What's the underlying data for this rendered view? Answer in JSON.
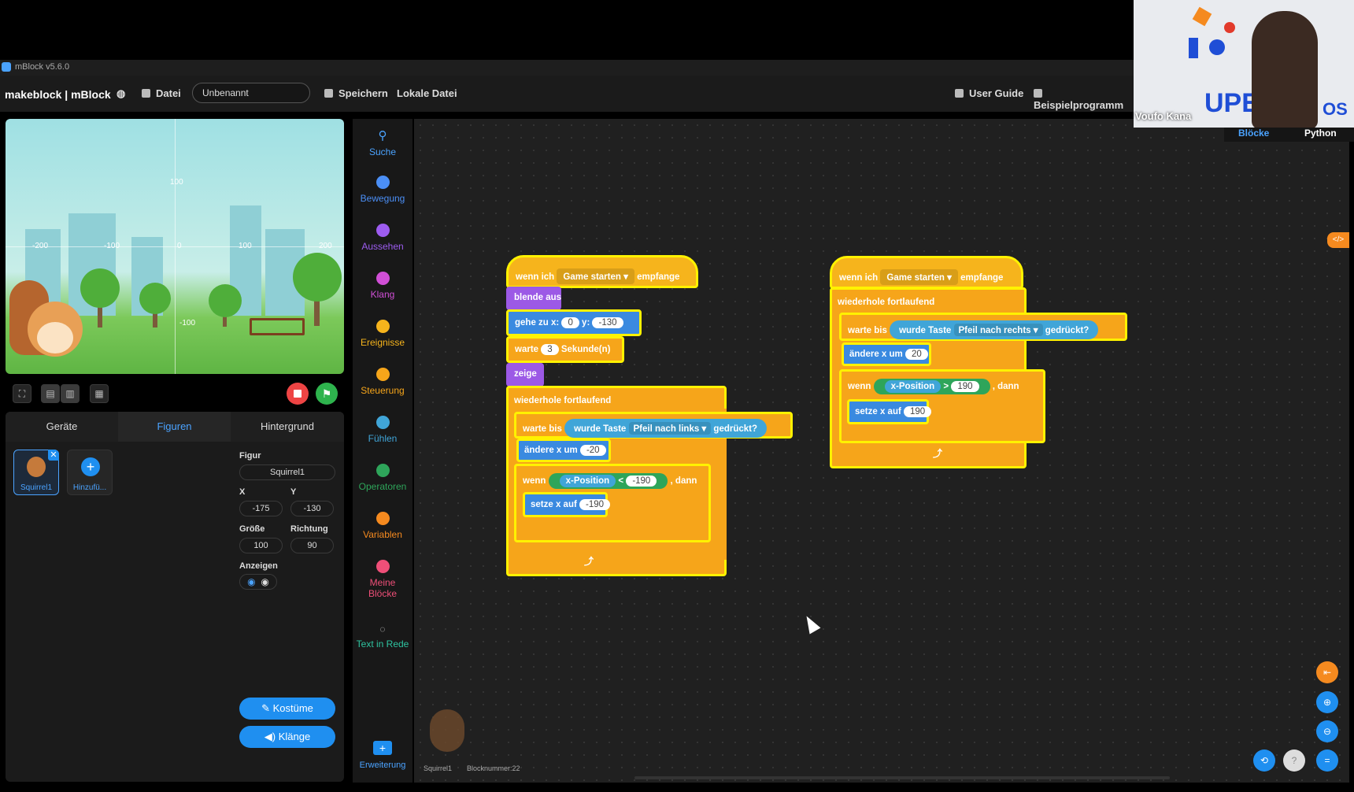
{
  "window": {
    "title": "mBlock v5.6.0"
  },
  "menu": {
    "brand": "makeblock | mBlock",
    "file": "Datei",
    "project_name": "Unbenannt",
    "save": "Speichern",
    "local_file": "Lokale Datei",
    "user_guide": "User Guide",
    "examples": "Beispielprogramm"
  },
  "stage": {
    "grid_labels": {
      "top": "100",
      "left1": "-200",
      "left2": "-100",
      "zero": "0",
      "right1": "100",
      "right2": "200",
      "bottom": "-100"
    }
  },
  "panel": {
    "tabs": [
      "Geräte",
      "Figuren",
      "Hintergrund"
    ],
    "sprites": [
      {
        "name": "Squirrel1"
      },
      {
        "name": "Hinzufü..."
      }
    ],
    "fields": {
      "figure_label": "Figur",
      "figure_value": "Squirrel1",
      "x_label": "X",
      "x_value": "-175",
      "y_label": "Y",
      "y_value": "-130",
      "size_label": "Größe",
      "size_value": "100",
      "dir_label": "Richtung",
      "dir_value": "90",
      "show_label": "Anzeigen"
    },
    "costumes": "Kostüme",
    "sounds": "Klänge"
  },
  "categories": [
    {
      "label": "Suche",
      "color": "#4ba3ff"
    },
    {
      "label": "Bewegung",
      "color": "#4b8ff6"
    },
    {
      "label": "Aussehen",
      "color": "#9d5cf0"
    },
    {
      "label": "Klang",
      "color": "#d04fd6"
    },
    {
      "label": "Ereignisse",
      "color": "#f6b41c"
    },
    {
      "label": "Steuerung",
      "color": "#f6a51a"
    },
    {
      "label": "Fühlen",
      "color": "#40a5d8"
    },
    {
      "label": "Operatoren",
      "color": "#2ea55a"
    },
    {
      "label": "Variablen",
      "color": "#f58a1f"
    },
    {
      "label": "Meine Blöcke",
      "color": "#ef4f78"
    },
    {
      "label": "Text in Rede",
      "color": "#2ec4a0"
    },
    {
      "label": "Erweiterung",
      "color": "#4ba3ff"
    }
  ],
  "script1": {
    "hat_pre": "wenn ich",
    "hat_msg": "Game starten ▾",
    "hat_post": "empfange",
    "hide": "blende aus",
    "goto": "gehe zu x:",
    "goto_x": "0",
    "goto_y_label": "y:",
    "goto_y": "-130",
    "wait": "warte",
    "wait_n": "3",
    "wait_unit": "Sekunde(n)",
    "show": "zeige",
    "forever": "wiederhole fortlaufend",
    "wait_until": "warte bis",
    "key_pressed": "wurde Taste",
    "key": "Pfeil nach links ▾",
    "pressed_q": "gedrückt?",
    "change_x": "ändere x um",
    "change_x_v": "-20",
    "if": "wenn",
    "xpos": "x-Position",
    "op": "<",
    "op_v": "-190",
    "then": ", dann",
    "set_x": "setze x auf",
    "set_x_v": "-190"
  },
  "script2": {
    "hat_pre": "wenn ich",
    "hat_msg": "Game starten ▾",
    "hat_post": "empfange",
    "forever": "wiederhole fortlaufend",
    "wait_until": "warte bis",
    "key_pressed": "wurde Taste",
    "key": "Pfeil nach rechts ▾",
    "pressed_q": "gedrückt?",
    "change_x": "ändere x um",
    "change_x_v": "20",
    "if": "wenn",
    "xpos": "x-Position",
    "op": ">",
    "op_v": "190",
    "then": ", dann",
    "set_x": "setze x auf",
    "set_x_v": "190"
  },
  "workspace": {
    "sprite_name": "Squirrel1",
    "block_count": "Blocknummer:22"
  },
  "modes": {
    "blocks": "Blöcke",
    "python": "Python"
  },
  "video": {
    "name": "Voufo Kana"
  }
}
